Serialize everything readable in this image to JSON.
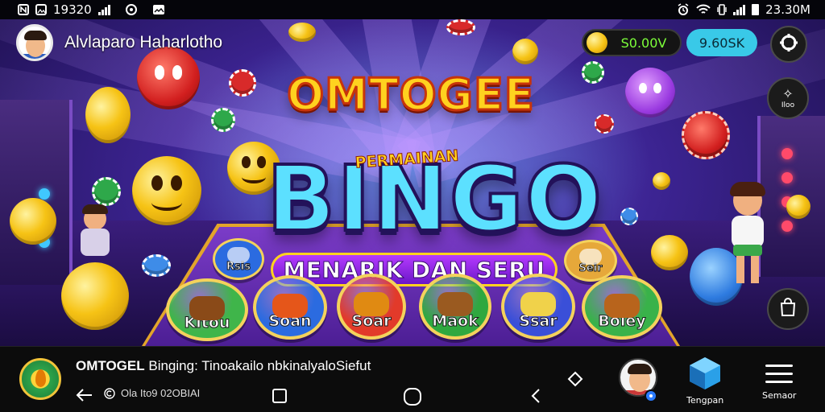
{
  "status_bar": {
    "time_left": "19320",
    "time_right": "23.30M"
  },
  "header": {
    "user_name": "Alvlaparo Haharlotho",
    "balance": "S0.00V",
    "action_button": "9.60SK",
    "side_button_label": "Iloo"
  },
  "game": {
    "title_top": "OMTOGEE",
    "title_sub": "PERMAINAN",
    "title_main": "BINGO",
    "banner": "MENARIK DAN SERU",
    "buttons": [
      {
        "label": "Kitou",
        "color": "#3fb54a",
        "food": "#8a4a18"
      },
      {
        "label": "Soan",
        "color": "#2b6be0",
        "food": "#e5561a"
      },
      {
        "label": "Soar",
        "color": "#e23a2a",
        "food": "#e08a12"
      },
      {
        "label": "Maok",
        "color": "#2fa83f",
        "food": "#9a5a20"
      },
      {
        "label": "Ssar",
        "color": "#3a4fd8",
        "food": "#f0d24a"
      },
      {
        "label": "Boley",
        "color": "#39b24a",
        "food": "#b8641c"
      }
    ],
    "small_buttons": [
      {
        "label": "Rsis",
        "color": "#2b6be0"
      },
      {
        "label": "Seir",
        "color": "#e6a83a"
      }
    ]
  },
  "bottom_bar": {
    "app_title_bold": "OMTOGEL",
    "app_title_rest": " Binging: Tinoakailo nbkinalyaloSiefut",
    "app_meta": "Ola Ito9 02OBIAI",
    "dock": [
      {
        "label": "Tengpan",
        "icon": "cube-icon"
      },
      {
        "label": "Semaor",
        "icon": "menu-icon"
      }
    ]
  },
  "colors": {
    "accent_cyan": "#39c9e8",
    "balance_green": "#7dff3a",
    "title_yellow": "#ffd21f",
    "bingo_blue": "#5ce0ff"
  }
}
